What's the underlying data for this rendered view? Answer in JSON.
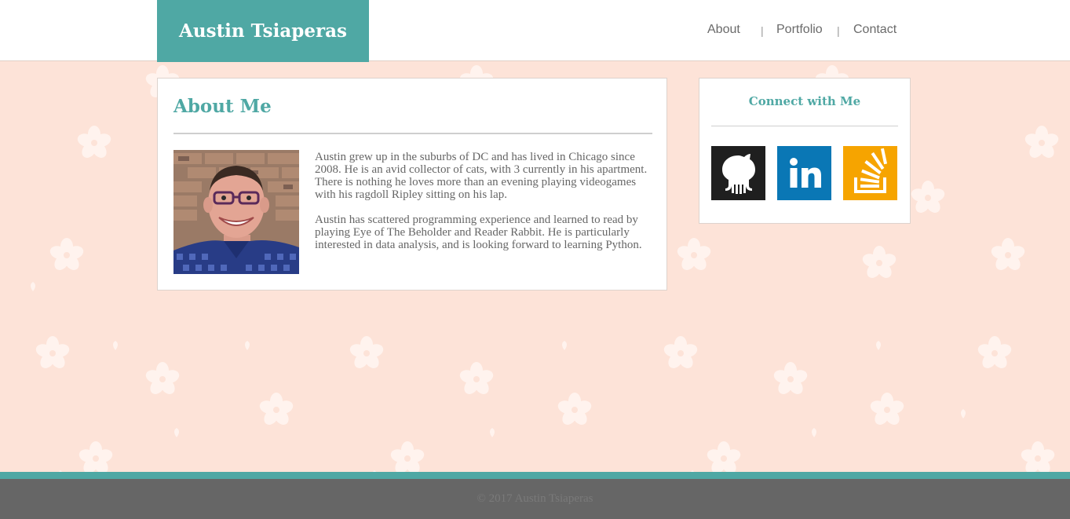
{
  "header": {
    "brand": "Austin Tsiaperas",
    "nav": [
      {
        "label": "About"
      },
      {
        "label": "Portfolio"
      },
      {
        "label": "Contact"
      }
    ],
    "separator": "|"
  },
  "about": {
    "title": "About Me",
    "avatar_icon": "profile-photo",
    "paragraphs": [
      "Austin grew up in the suburbs of DC and has lived in Chicago since 2008. He is an avid collector of cats, with 3 currently in his apartment. There is nothing he loves more than an evening playing videogames with his ragdoll Ripley sitting on his lap.",
      "Austin has scattered programming experience and learned to read by playing Eye of The Beholder and Reader Rabbit. He is particularly interested in data analysis, and is looking forward to learning Python."
    ]
  },
  "connect": {
    "title": "Connect with Me",
    "links": [
      {
        "icon": "github-icon",
        "color": "#1f1f1f"
      },
      {
        "icon": "linkedin-icon",
        "color": "#0a77b5"
      },
      {
        "icon": "stackoverflow-icon",
        "color": "#f6a400"
      }
    ]
  },
  "footer": {
    "copyright": "© 2017 Austin Tsiaperas"
  },
  "colors": {
    "accent": "#4fa8a4",
    "background": "#fde3d8",
    "footer": "#666666"
  }
}
